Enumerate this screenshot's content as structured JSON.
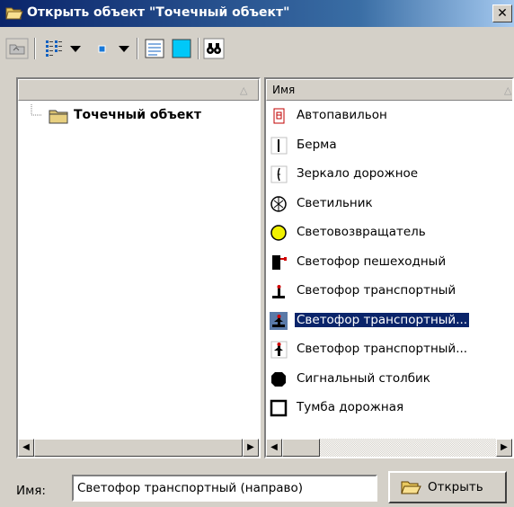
{
  "window": {
    "title": "Открыть объект \"Точечный объект\"",
    "close_glyph": "✕"
  },
  "toolbar": {
    "items": [
      {
        "name": "folder-up-icon"
      },
      {
        "name": "view-list-icon"
      },
      {
        "name": "view-dropdown-arrow"
      },
      {
        "name": "small-icon-view"
      },
      {
        "name": "icon-dropdown-arrow"
      },
      {
        "name": "details-view-icon"
      },
      {
        "name": "preview-toggle-icon"
      },
      {
        "name": "find-binoculars-icon"
      }
    ]
  },
  "tree": {
    "sort_indicator": "△",
    "root_label": "Точечный объект"
  },
  "list": {
    "column_header": "Имя",
    "sort_indicator": "△",
    "items": [
      {
        "label": "Автопавильон",
        "icon": "bus-stop-icon"
      },
      {
        "label": "Берма",
        "icon": "berm-line-icon"
      },
      {
        "label": "Зеркало дорожное",
        "icon": "road-mirror-icon"
      },
      {
        "label": "Светильник",
        "icon": "lamp-icon"
      },
      {
        "label": "Световозвращатель",
        "icon": "reflector-icon"
      },
      {
        "label": "Светофор пешеходный",
        "icon": "pedestrian-light-icon"
      },
      {
        "label": "Светофор транспортный",
        "icon": "traffic-light-icon"
      },
      {
        "label": "Светофор транспортный...",
        "icon": "traffic-light-right-icon",
        "selected": true
      },
      {
        "label": "Светофор транспортный...",
        "icon": "traffic-light-left-icon"
      },
      {
        "label": "Сигнальный столбик",
        "icon": "signal-post-icon"
      },
      {
        "label": "Тумба дорожная",
        "icon": "road-bollard-icon"
      }
    ]
  },
  "footer": {
    "name_label": "Имя:",
    "name_value": "Светофор транспортный (направо)",
    "open_button": "Открыть"
  },
  "colors": {
    "title_bar": "#0a246a",
    "selection": "#0a246a",
    "face": "#d4d0c8"
  }
}
